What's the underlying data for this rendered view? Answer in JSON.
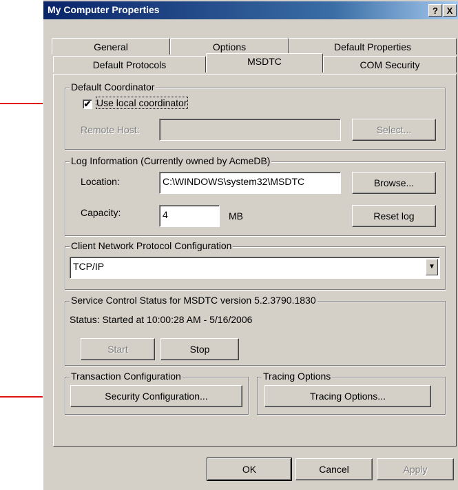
{
  "window": {
    "title": "My Computer Properties",
    "help_btn": "?",
    "close_btn": "X"
  },
  "tabs_row_back": [
    "General",
    "Options",
    "Default Properties"
  ],
  "tabs_row_front": [
    "Default Protocols",
    "MSDTC",
    "COM Security"
  ],
  "default_coordinator": {
    "legend": "Default Coordinator",
    "use_local_label": "Use local coordinator",
    "use_local_checked": true,
    "check_mark": "✔",
    "remote_host_label": "Remote Host:",
    "remote_host_value": "",
    "select_button": "Select..."
  },
  "log_info": {
    "legend": "Log Information (Currently owned by AcmeDB)",
    "location_label": "Location:",
    "location_value": "C:\\WINDOWS\\system32\\MSDTC",
    "browse_button": "Browse...",
    "capacity_label": "Capacity:",
    "capacity_value": "4",
    "capacity_unit": "MB",
    "reset_button": "Reset log"
  },
  "network_protocol": {
    "legend": "Client Network Protocol Configuration",
    "selected": "TCP/IP",
    "dropdown_glyph": "▼"
  },
  "service_control": {
    "legend": "Service Control Status for MSDTC version 5.2.3790.1830",
    "status_text": "Status: Started at 10:00:28 AM - 5/16/2006",
    "start_button": "Start",
    "stop_button": "Stop"
  },
  "transaction": {
    "legend": "Transaction Configuration",
    "security_button": "Security Configuration..."
  },
  "tracing": {
    "legend": "Tracing Options",
    "tracing_button": "Tracing Options..."
  },
  "footer": {
    "ok": "OK",
    "cancel": "Cancel",
    "apply": "Apply"
  },
  "colors": {
    "accent_arrow": "#e01010",
    "title_bar": "#0a246a",
    "dialog_bg": "#d4d0c8"
  }
}
